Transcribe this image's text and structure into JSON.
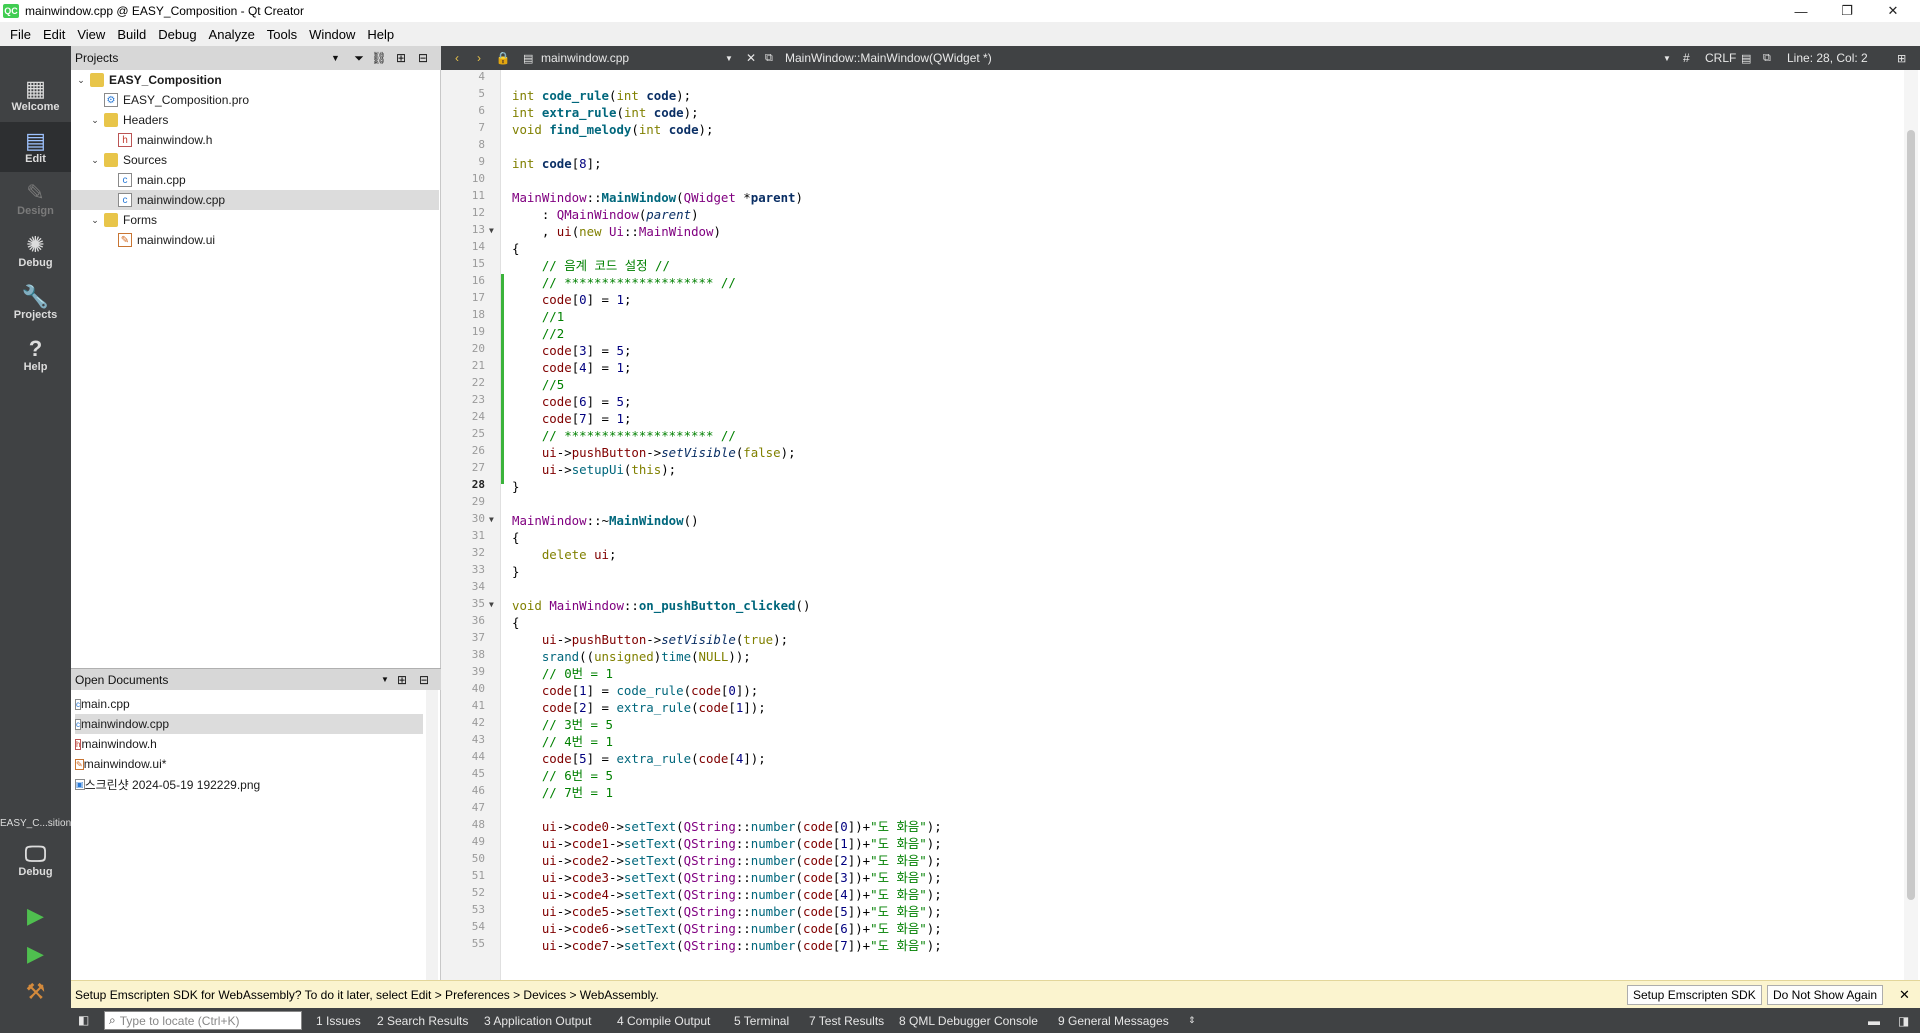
{
  "window": {
    "title": "mainwindow.cpp @ EASY_Composition - Qt Creator",
    "app_badge": "QC",
    "controls": [
      "—",
      "❐",
      "✕"
    ]
  },
  "menu": [
    "File",
    "Edit",
    "View",
    "Build",
    "Debug",
    "Analyze",
    "Tools",
    "Window",
    "Help"
  ],
  "modes": [
    {
      "label": "Welcome",
      "icon": "grid-icon"
    },
    {
      "label": "Edit",
      "icon": "edit-doc-icon"
    },
    {
      "label": "Design",
      "icon": "pen-icon"
    },
    {
      "label": "Debug",
      "icon": "bug-icon"
    },
    {
      "label": "Projects",
      "icon": "wrench-icon"
    },
    {
      "label": "Help",
      "icon": "help-icon"
    }
  ],
  "kit": {
    "name": "EASY_C...sition",
    "mode": "Debug"
  },
  "projects_pane": {
    "title": "Projects",
    "tree": [
      {
        "label": "EASY_Composition",
        "depth": 0,
        "type": "project",
        "expanded": true
      },
      {
        "label": "EASY_Composition.pro",
        "depth": 1,
        "type": "pro"
      },
      {
        "label": "Headers",
        "depth": 1,
        "type": "folder",
        "expanded": true
      },
      {
        "label": "mainwindow.h",
        "depth": 2,
        "type": "h"
      },
      {
        "label": "Sources",
        "depth": 1,
        "type": "folder",
        "expanded": true
      },
      {
        "label": "main.cpp",
        "depth": 2,
        "type": "cpp"
      },
      {
        "label": "mainwindow.cpp",
        "depth": 2,
        "type": "cpp",
        "selected": true
      },
      {
        "label": "Forms",
        "depth": 1,
        "type": "folder",
        "expanded": true
      },
      {
        "label": "mainwindow.ui",
        "depth": 2,
        "type": "ui"
      }
    ]
  },
  "open_documents": {
    "title": "Open Documents",
    "items": [
      {
        "label": "main.cpp",
        "type": "cpp"
      },
      {
        "label": "mainwindow.cpp",
        "type": "cpp",
        "selected": true
      },
      {
        "label": "mainwindow.h",
        "type": "h"
      },
      {
        "label": "mainwindow.ui*",
        "type": "ui"
      },
      {
        "label": "스크린샷 2024-05-19 192229.png",
        "type": "png"
      }
    ]
  },
  "editor_toolbar": {
    "file": "mainwindow.cpp",
    "symbol": "MainWindow::MainWindow(QWidget *)",
    "encoding_hash": "#",
    "line_ending": "CRLF",
    "position": "Line: 28, Col: 2"
  },
  "editor": {
    "current_line": 28,
    "lines": [
      {
        "n": 4,
        "html": ""
      },
      {
        "n": 5,
        "html": "<span class='kw'>int</span> <span class='fn'>code_rule</span>(<span class='kw'>int</span> <span class='param'>code</span>);"
      },
      {
        "n": 6,
        "html": "<span class='kw'>int</span> <span class='fn'>extra_rule</span>(<span class='kw'>int</span> <span class='param'>code</span>);"
      },
      {
        "n": 7,
        "html": "<span class='kw'>void</span> <span class='fn'>find_melody</span>(<span class='kw'>int</span> <span class='param'>code</span>);"
      },
      {
        "n": 8,
        "html": ""
      },
      {
        "n": 9,
        "html": "<span class='kw'>int</span> <span class='var'>code</span>[<span class='num'>8</span>];"
      },
      {
        "n": 10,
        "html": ""
      },
      {
        "n": 11,
        "html": "<span class='ty'>MainWindow</span>::<span class='fn'>MainWindow</span>(<span class='ty'>QWidget</span> *<span class='param'>parent</span>)"
      },
      {
        "n": 12,
        "html": "    : <span class='ty'>QMainWindow</span>(<span class='italic'>parent</span>)"
      },
      {
        "n": 13,
        "html": "    , <span class='mem'>ui</span>(<span class='kw'>new</span> <span class='ty'>Ui</span>::<span class='ty'>MainWindow</span>)",
        "fold": true
      },
      {
        "n": 14,
        "html": "{"
      },
      {
        "n": 15,
        "html": "    <span class='cm'>// 음계 코드 설정 //</span>"
      },
      {
        "n": 16,
        "html": "    <span class='cm'>// ******************** //</span>"
      },
      {
        "n": 17,
        "html": "    <span class='mem'>code</span>[<span class='num'>0</span>] = <span class='num'>1</span>;"
      },
      {
        "n": 18,
        "html": "    <span class='cm'>//1</span>"
      },
      {
        "n": 19,
        "html": "    <span class='cm'>//2</span>"
      },
      {
        "n": 20,
        "html": "    <span class='mem'>code</span>[<span class='num'>3</span>] = <span class='num'>5</span>;"
      },
      {
        "n": 21,
        "html": "    <span class='mem'>code</span>[<span class='num'>4</span>] = <span class='num'>1</span>;"
      },
      {
        "n": 22,
        "html": "    <span class='cm'>//5</span>"
      },
      {
        "n": 23,
        "html": "    <span class='mem'>code</span>[<span class='num'>6</span>] = <span class='num'>5</span>;"
      },
      {
        "n": 24,
        "html": "    <span class='mem'>code</span>[<span class='num'>7</span>] = <span class='num'>1</span>;"
      },
      {
        "n": 25,
        "html": "    <span class='cm'>// ******************** //</span>"
      },
      {
        "n": 26,
        "html": "    <span class='mem'>ui</span>-&gt;<span class='mem'>pushButton</span>-&gt;<span class='italic'>setVisible</span>(<span class='kw'>false</span>);"
      },
      {
        "n": 27,
        "html": "    <span class='mem'>ui</span>-&gt;<span class='call'>setupUi</span>(<span class='kw'>this</span>);"
      },
      {
        "n": 28,
        "html": "}"
      },
      {
        "n": 29,
        "html": ""
      },
      {
        "n": 30,
        "html": "<span class='ty'>MainWindow</span>::~<span class='fn'>MainWindow</span>()",
        "fold": true
      },
      {
        "n": 31,
        "html": "{"
      },
      {
        "n": 32,
        "html": "    <span class='kw'>delete</span> <span class='mem'>ui</span>;"
      },
      {
        "n": 33,
        "html": "}"
      },
      {
        "n": 34,
        "html": ""
      },
      {
        "n": 35,
        "html": "<span class='kw'>void</span> <span class='ty'>MainWindow</span>::<span class='fn'>on_pushButton_clicked</span>()",
        "fold": true
      },
      {
        "n": 36,
        "html": "{"
      },
      {
        "n": 37,
        "html": "    <span class='mem'>ui</span>-&gt;<span class='mem'>pushButton</span>-&gt;<span class='italic'>setVisible</span>(<span class='kw'>true</span>);"
      },
      {
        "n": 38,
        "html": "    <span class='call'>srand</span>((<span class='kw'>unsigned</span>)<span class='call'>time</span>(<span class='kw'>NULL</span>));"
      },
      {
        "n": 39,
        "html": "    <span class='cm'>// 0번 = 1</span>"
      },
      {
        "n": 40,
        "html": "    <span class='mem'>code</span>[<span class='num'>1</span>] = <span class='call'>code_rule</span>(<span class='mem'>code</span>[<span class='num'>0</span>]);"
      },
      {
        "n": 41,
        "html": "    <span class='mem'>code</span>[<span class='num'>2</span>] = <span class='call'>extra_rule</span>(<span class='mem'>code</span>[<span class='num'>1</span>]);"
      },
      {
        "n": 42,
        "html": "    <span class='cm'>// 3번 = 5</span>"
      },
      {
        "n": 43,
        "html": "    <span class='cm'>// 4번 = 1</span>"
      },
      {
        "n": 44,
        "html": "    <span class='mem'>code</span>[<span class='num'>5</span>] = <span class='call'>extra_rule</span>(<span class='mem'>code</span>[<span class='num'>4</span>]);"
      },
      {
        "n": 45,
        "html": "    <span class='cm'>// 6번 = 5</span>"
      },
      {
        "n": 46,
        "html": "    <span class='cm'>// 7번 = 1</span>"
      },
      {
        "n": 47,
        "html": ""
      },
      {
        "n": 48,
        "html": "    <span class='mem'>ui</span>-&gt;<span class='mem'>code0</span>-&gt;<span class='call'>setText</span>(<span class='ty'>QString</span>::<span class='call'>number</span>(<span class='mem'>code</span>[<span class='num'>0</span>])+<span class='str'>\"도 화음\"</span>);"
      },
      {
        "n": 49,
        "html": "    <span class='mem'>ui</span>-&gt;<span class='mem'>code1</span>-&gt;<span class='call'>setText</span>(<span class='ty'>QString</span>::<span class='call'>number</span>(<span class='mem'>code</span>[<span class='num'>1</span>])+<span class='str'>\"도 화음\"</span>);"
      },
      {
        "n": 50,
        "html": "    <span class='mem'>ui</span>-&gt;<span class='mem'>code2</span>-&gt;<span class='call'>setText</span>(<span class='ty'>QString</span>::<span class='call'>number</span>(<span class='mem'>code</span>[<span class='num'>2</span>])+<span class='str'>\"도 화음\"</span>);"
      },
      {
        "n": 51,
        "html": "    <span class='mem'>ui</span>-&gt;<span class='mem'>code3</span>-&gt;<span class='call'>setText</span>(<span class='ty'>QString</span>::<span class='call'>number</span>(<span class='mem'>code</span>[<span class='num'>3</span>])+<span class='str'>\"도 화음\"</span>);"
      },
      {
        "n": 52,
        "html": "    <span class='mem'>ui</span>-&gt;<span class='mem'>code4</span>-&gt;<span class='call'>setText</span>(<span class='ty'>QString</span>::<span class='call'>number</span>(<span class='mem'>code</span>[<span class='num'>4</span>])+<span class='str'>\"도 화음\"</span>);"
      },
      {
        "n": 53,
        "html": "    <span class='mem'>ui</span>-&gt;<span class='mem'>code5</span>-&gt;<span class='call'>setText</span>(<span class='ty'>QString</span>::<span class='call'>number</span>(<span class='mem'>code</span>[<span class='num'>5</span>])+<span class='str'>\"도 화음\"</span>);"
      },
      {
        "n": 54,
        "html": "    <span class='mem'>ui</span>-&gt;<span class='mem'>code6</span>-&gt;<span class='call'>setText</span>(<span class='ty'>QString</span>::<span class='call'>number</span>(<span class='mem'>code</span>[<span class='num'>6</span>])+<span class='str'>\"도 화음\"</span>);"
      },
      {
        "n": 55,
        "html": "    <span class='mem'>ui</span>-&gt;<span class='mem'>code7</span>-&gt;<span class='call'>setText</span>(<span class='ty'>QString</span>::<span class='call'>number</span>(<span class='mem'>code</span>[<span class='num'>7</span>])+<span class='str'>\"도 화음\"</span>);"
      }
    ]
  },
  "infobar": {
    "message": "Setup Emscripten SDK for WebAssembly? To do it later, select Edit > Preferences > Devices > WebAssembly.",
    "setup_button": "Setup Emscripten SDK",
    "dismiss_button": "Do Not Show Again"
  },
  "output_bar": {
    "locator_placeholder": "Type to locate (Ctrl+K)",
    "panes": [
      "1  Issues",
      "2  Search Results",
      "3  Application Output",
      "4  Compile Output",
      "5  Terminal",
      "7  Test Results",
      "8  QML Debugger Console",
      "9  General Messages"
    ]
  },
  "colors": {
    "modebar": "#404244",
    "accent_green": "#41cd52",
    "infobar": "#fbf4cf"
  }
}
